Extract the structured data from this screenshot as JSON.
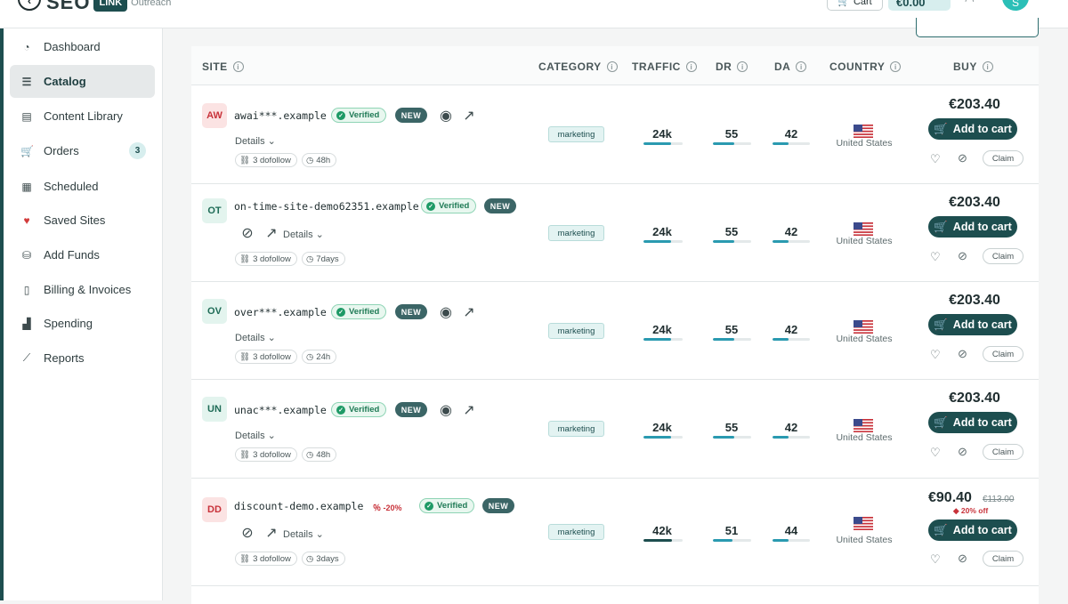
{
  "topbar": {
    "logo_main": "SEO",
    "logo_badge": "LINK",
    "logo_sub": "Outreach",
    "cart_label": "Cart",
    "balance": "€0.00",
    "avatar_initial": "S"
  },
  "sidebar": {
    "items": [
      {
        "label": "Dashboard",
        "icon": "gauge-icon"
      },
      {
        "label": "Catalog",
        "icon": "list-icon",
        "active": true
      },
      {
        "label": "Content Library",
        "icon": "doc-icon"
      },
      {
        "label": "Orders",
        "icon": "cart-icon",
        "badge": "3"
      },
      {
        "label": "Scheduled",
        "icon": "calendar-icon"
      },
      {
        "label": "Saved Sites",
        "icon": "heart-icon"
      },
      {
        "label": "Add Funds",
        "icon": "coins-icon"
      },
      {
        "label": "Billing & Invoices",
        "icon": "invoice-icon"
      },
      {
        "label": "Spending",
        "icon": "bar-chart-icon"
      },
      {
        "label": "Reports",
        "icon": "line-chart-icon"
      }
    ]
  },
  "table": {
    "headers": {
      "site": "SITE",
      "category": "CATEGORY",
      "traffic": "TRAFFIC",
      "dr": "DR",
      "da": "DA",
      "country": "COUNTRY",
      "buy": "BUY"
    },
    "rows": [
      {
        "initials": "AW",
        "initials_color": "red",
        "site": "awai***.example",
        "verified": "Verified",
        "new": "NEW",
        "details": "Details",
        "dofollow": "3 dofollow",
        "tat": "48h",
        "category": "marketing",
        "traffic": "24k",
        "dr": "55",
        "da": "42",
        "traffic_pct": 0.7,
        "dr_pct": 0.55,
        "da_pct": 0.42,
        "country": "United States",
        "price": "€203.40",
        "add": "Add to cart",
        "claim": "Claim"
      },
      {
        "initials": "OT",
        "initials_color": "green",
        "site": "on-time-site-demo62351.example",
        "verified": "Verified",
        "new": "NEW",
        "details": "Details",
        "dofollow": "3 dofollow",
        "tat": "7days",
        "category": "marketing",
        "traffic": "24k",
        "dr": "55",
        "da": "42",
        "traffic_pct": 0.7,
        "dr_pct": 0.55,
        "da_pct": 0.42,
        "country": "United States",
        "price": "€203.40",
        "add": "Add to cart",
        "claim": "Claim"
      },
      {
        "initials": "OV",
        "initials_color": "green",
        "site": "over***.example",
        "verified": "Verified",
        "new": "NEW",
        "details": "Details",
        "dofollow": "3 dofollow",
        "tat": "24h",
        "category": "marketing",
        "traffic": "24k",
        "dr": "55",
        "da": "42",
        "traffic_pct": 0.7,
        "dr_pct": 0.55,
        "da_pct": 0.42,
        "country": "United States",
        "price": "€203.40",
        "add": "Add to cart",
        "claim": "Claim"
      },
      {
        "initials": "UN",
        "initials_color": "green",
        "site": "unac***.example",
        "verified": "Verified",
        "new": "NEW",
        "details": "Details",
        "dofollow": "3 dofollow",
        "tat": "48h",
        "category": "marketing",
        "traffic": "24k",
        "dr": "55",
        "da": "42",
        "traffic_pct": 0.7,
        "dr_pct": 0.55,
        "da_pct": 0.42,
        "country": "United States",
        "price": "€203.40",
        "add": "Add to cart",
        "claim": "Claim"
      },
      {
        "initials": "DD",
        "initials_color": "red",
        "site": "discount-demo.example",
        "discount": "-20%",
        "verified": "Verified",
        "new": "NEW",
        "details": "Details",
        "dofollow": "3 dofollow",
        "tat": "3days",
        "category": "marketing",
        "traffic": "42k",
        "dr": "51",
        "da": "44",
        "traffic_pct": 0.72,
        "dr_pct": 0.51,
        "da_pct": 0.44,
        "country": "United States",
        "price": "€90.40",
        "old_price": "€113.00",
        "off": "20% off",
        "add": "Add to cart",
        "claim": "Claim"
      }
    ]
  },
  "colors": {
    "brand": "#1d4e4f",
    "accent_bar": "#2a9ab0",
    "verified_green": "#1e7a55",
    "discount_red": "#c8323a"
  }
}
